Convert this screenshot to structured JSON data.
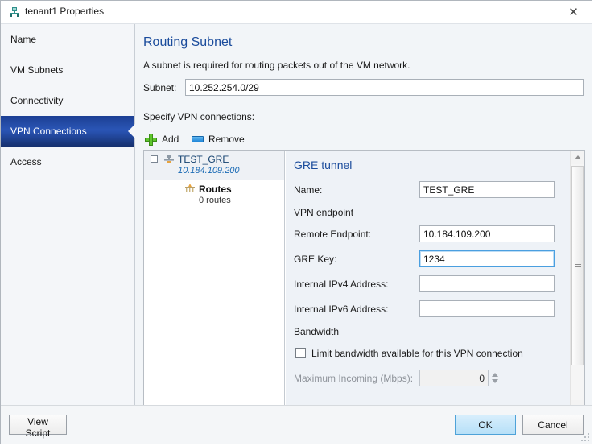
{
  "window": {
    "title": "tenant1 Properties",
    "icon": "network-vm-icon",
    "close_label": "✕"
  },
  "sidebar": {
    "items": [
      {
        "label": "Name",
        "selected": false
      },
      {
        "label": "VM Subnets",
        "selected": false
      },
      {
        "label": "Connectivity",
        "selected": false
      },
      {
        "label": "VPN Connections",
        "selected": true
      },
      {
        "label": "Access",
        "selected": false
      }
    ]
  },
  "main": {
    "title": "Routing Subnet",
    "description": "A subnet is required for routing packets out of the VM network.",
    "subnet": {
      "label": "Subnet:",
      "value": "10.252.254.0/29",
      "placeholder": ""
    },
    "specify_label": "Specify VPN connections:",
    "toolbar": {
      "add_label": "Add",
      "add_icon": "plus-icon",
      "remove_label": "Remove",
      "remove_icon": "minus-icon"
    },
    "tree": {
      "root": {
        "name": "TEST_GRE",
        "address": "10.184.109.200",
        "icon": "vpn-tunnel-icon",
        "expander": "collapse-icon"
      },
      "child": {
        "name": "Routes",
        "detail": "0 routes",
        "icon": "routes-icon"
      }
    },
    "detail": {
      "title": "GRE tunnel",
      "fields": [
        {
          "label": "Name:",
          "value": "TEST_GRE",
          "focused": false
        },
        {
          "label": "Remote Endpoint:",
          "value": "10.184.109.200",
          "focused": false
        },
        {
          "label": "GRE Key:",
          "value": "1234",
          "focused": true
        },
        {
          "label": "Internal IPv4 Address:",
          "value": "",
          "focused": false
        },
        {
          "label": "Internal IPv6 Address:",
          "value": "",
          "focused": false
        }
      ],
      "group_vpn_endpoint": "VPN endpoint",
      "group_bandwidth": "Bandwidth",
      "limit_checkbox": {
        "label": "Limit bandwidth available for this VPN connection",
        "checked": false
      },
      "max_incoming": {
        "label": "Maximum Incoming (Mbps):",
        "value": "0",
        "enabled": false
      }
    }
  },
  "footer": {
    "view_script": "View Script",
    "ok": "OK",
    "cancel": "Cancel"
  },
  "colors": {
    "accent_blue": "#1b4c9c",
    "selected_nav": "#2a55b5",
    "focus_border": "#4a9fe0",
    "add_icon_green": "#5fc62c",
    "remove_icon_blue": "#1f86d8"
  }
}
